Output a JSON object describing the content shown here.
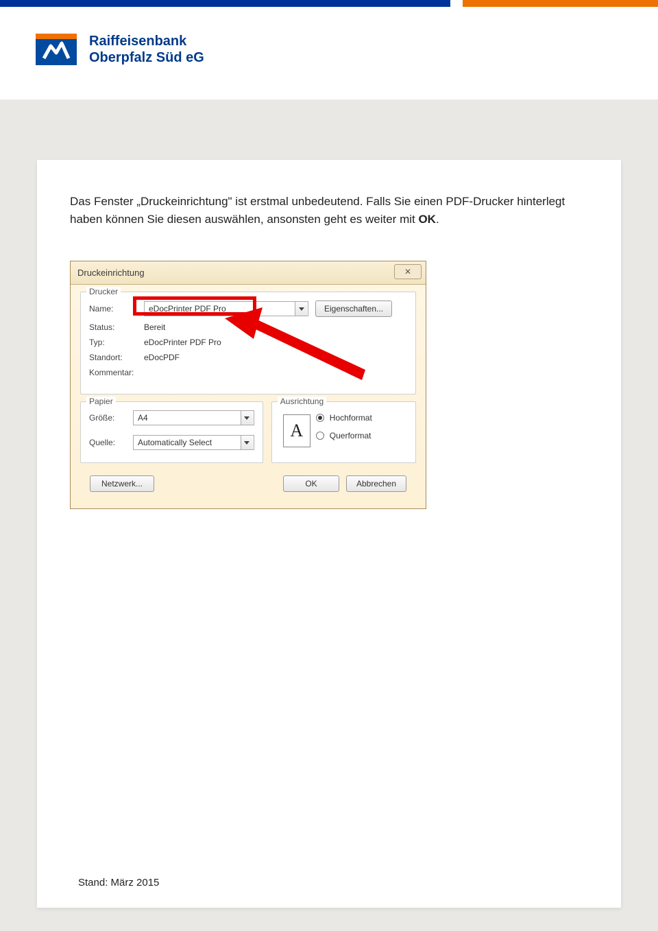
{
  "header": {
    "bank_line1": "Raiffeisenbank",
    "bank_line2": "Oberpfalz Süd eG"
  },
  "intro": {
    "line1": "Das Fenster „Druckeinrichtung\" ist erstmal unbedeutend. Falls Sie einen PDF-Drucker hinterlegt haben können Sie diesen auswählen, ansonsten geht es weiter mit ",
    "bold": "OK",
    "tail": "."
  },
  "dialog": {
    "title": "Druckeinrichtung",
    "close_glyph": "✕",
    "printer": {
      "legend": "Drucker",
      "name_label": "Name:",
      "name_value": "eDocPrinter PDF Pro",
      "properties_btn": "Eigenschaften...",
      "status_label": "Status:",
      "status_value": "Bereit",
      "type_label": "Typ:",
      "type_value": "eDocPrinter PDF Pro",
      "location_label": "Standort:",
      "location_value": "eDocPDF",
      "comment_label": "Kommentar:"
    },
    "paper": {
      "legend": "Papier",
      "size_label": "Größe:",
      "size_value": "A4",
      "source_label": "Quelle:",
      "source_value": "Automatically Select"
    },
    "orientation": {
      "legend": "Ausrichtung",
      "portrait": "Hochformat",
      "landscape": "Querformat",
      "icon_glyph": "A"
    },
    "footer": {
      "network_btn": "Netzwerk...",
      "ok_btn": "OK",
      "cancel_btn": "Abbrechen"
    }
  },
  "footer_text": "Stand: März 2015"
}
